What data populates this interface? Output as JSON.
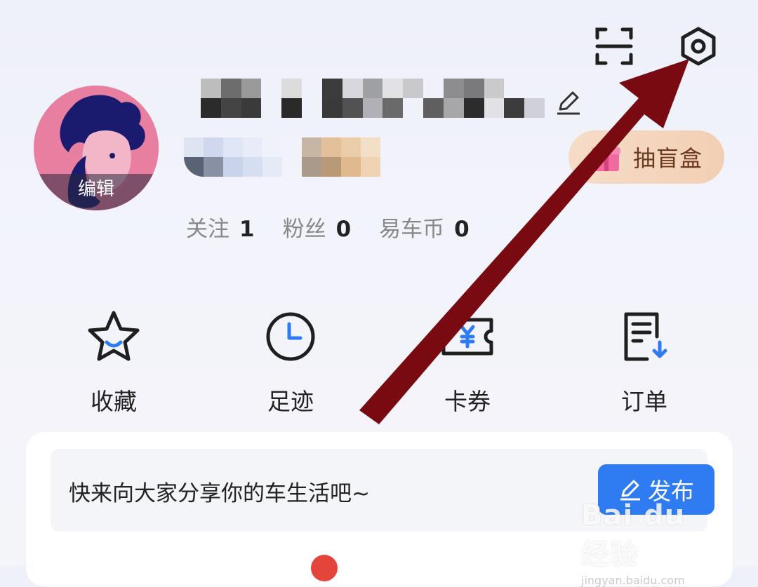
{
  "header": {
    "scan_icon": "scan-icon",
    "settings_icon": "settings-gear-icon"
  },
  "profile": {
    "avatar_edit_label": "编辑",
    "blind_box_label": "抽盲盒",
    "stats": [
      {
        "label": "关注",
        "value": "1"
      },
      {
        "label": "粉丝",
        "value": "0"
      },
      {
        "label": "易车币",
        "value": "0"
      }
    ]
  },
  "quick_actions": [
    {
      "label": "收藏",
      "icon": "star-icon"
    },
    {
      "label": "足迹",
      "icon": "clock-icon"
    },
    {
      "label": "卡券",
      "icon": "coupon-icon"
    },
    {
      "label": "订单",
      "icon": "order-icon"
    }
  ],
  "post": {
    "prompt": "快来向大家分享你的车生活吧~",
    "publish_label": "发布"
  },
  "watermark": {
    "main": "Bai du 经验",
    "sub": "jingyan.baidu.com"
  },
  "colors": {
    "accent_blue": "#2f7bf2",
    "arrow": "#7a0a12",
    "avatar_bg": "#e87fa0",
    "red_dot": "#e5443b"
  }
}
